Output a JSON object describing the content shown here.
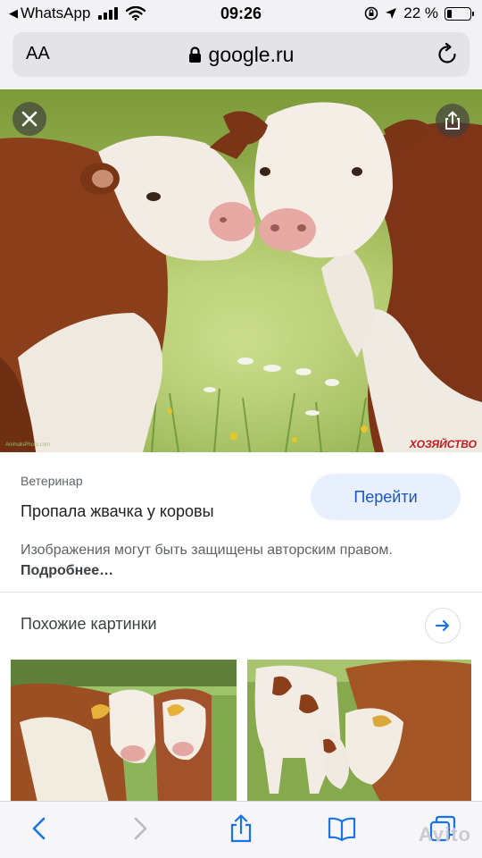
{
  "status_bar": {
    "back_app": "WhatsApp",
    "time": "09:26",
    "battery_percent": "22 %",
    "battery_level": 0.22
  },
  "address_bar": {
    "text_size_label": "AA",
    "url": "google.ru"
  },
  "image_view": {
    "watermark": "ХОЗЯЙСТВО",
    "credit_text": "AnimalsPhoto.com"
  },
  "result": {
    "source": "Ветеринар",
    "title": "Пропала жвачка у коровы",
    "visit_label": "Перейти",
    "copyright_text": "Изображения могут быть защищены авторским правом.",
    "more_link": "Подробнее…"
  },
  "related": {
    "title": "Похожие картинки"
  },
  "overlay": {
    "watermark": "Avito"
  },
  "icons": {
    "close": "close-icon",
    "share": "share-icon",
    "lock": "lock-icon",
    "reload": "reload-icon",
    "back": "chevron-left-icon",
    "forward": "chevron-right-icon",
    "bookmarks": "book-icon",
    "tabs": "tabs-icon",
    "arrow": "arrow-right-icon"
  },
  "colors": {
    "accent": "#1a73e8",
    "visit_bg": "#e8f0fe",
    "watermark": "#c6171b"
  }
}
